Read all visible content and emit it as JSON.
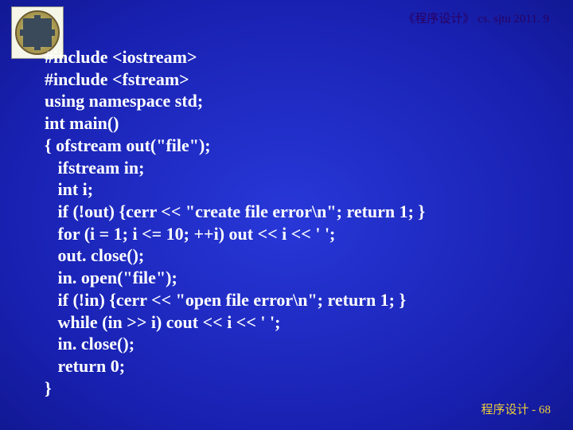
{
  "header": {
    "title": "《程序设计》 cs. sjtu  2011. 9"
  },
  "code": {
    "lines": [
      "#include <iostream>",
      "#include <fstream>",
      "using namespace std;",
      "int main()",
      "{ ofstream out(\"file\");",
      "   ifstream in;",
      "   int i;",
      "   if (!out) {cerr << \"create file error\\n\"; return 1; }",
      "   for (i = 1; i <= 10; ++i) out << i << ' ';",
      "   out. close();",
      "   in. open(\"file\");",
      "   if (!in) {cerr << \"open file error\\n\"; return 1; }",
      "   while (in >> i) cout << i << ' ';",
      "   in. close();",
      "   return 0;",
      "}"
    ]
  },
  "footer": {
    "text": "程序设计 - 68"
  }
}
